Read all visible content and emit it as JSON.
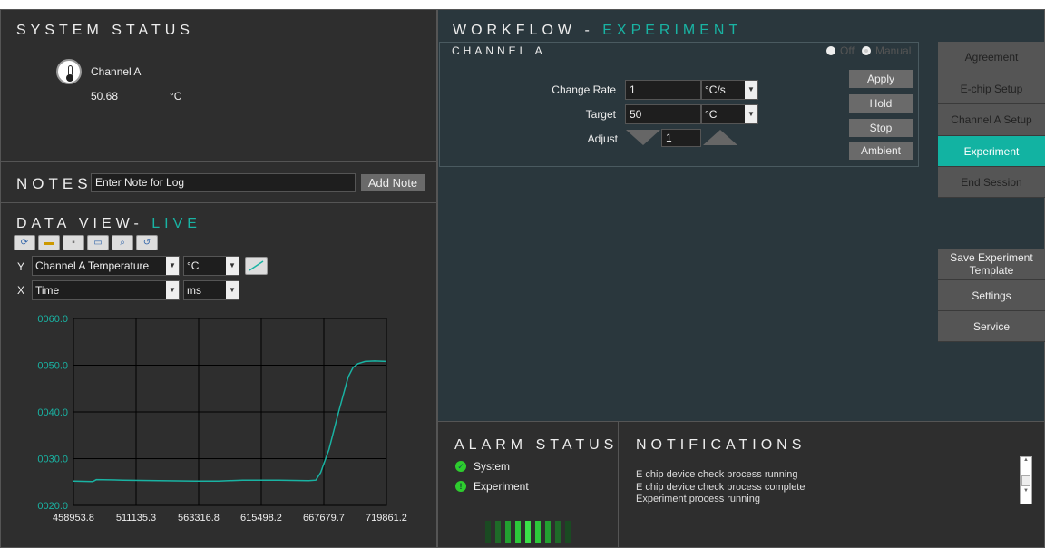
{
  "system_status": {
    "title": "SYSTEM STATUS",
    "channel": "Channel A",
    "value": "50.68",
    "unit": "°C"
  },
  "notes": {
    "title": "NOTES",
    "input_value": "Enter Note for Log",
    "add_label": "Add Note"
  },
  "data_view": {
    "title": "DATA VIEW-",
    "mode": "LIVE",
    "y_label": "Y",
    "y_select": "Channel A Temperature",
    "y_unit": "°C",
    "x_label": "X",
    "x_select": "Time",
    "x_unit": "ms",
    "toolbar": [
      "refresh-icon",
      "open-folder-icon",
      "save-icon",
      "new-window-icon",
      "zoom-fit-icon",
      "history-icon"
    ]
  },
  "chart_data": {
    "type": "line",
    "title": "",
    "xlabel": "",
    "ylabel": "",
    "xlim": [
      458953.8,
      719861.2
    ],
    "ylim": [
      20,
      60
    ],
    "x_ticks": [
      "458953.8",
      "511135.3",
      "563316.8",
      "615498.2",
      "667679.7",
      "719861.2"
    ],
    "y_ticks": [
      "0020.0",
      "0030.0",
      "0040.0",
      "0050.0",
      "0060.0"
    ],
    "grid": true,
    "color": "#19b3a3",
    "series": [
      {
        "name": "Channel A Temperature",
        "x": [
          458953.8,
          475000,
          478000,
          500000,
          530000,
          560000,
          580000,
          600000,
          630000,
          655000,
          661000,
          665000,
          672000,
          680000,
          688000,
          692000,
          696000,
          702000,
          710000,
          719861.2
        ],
        "y": [
          25.2,
          25.1,
          25.5,
          25.4,
          25.3,
          25.2,
          25.2,
          25.4,
          25.4,
          25.3,
          25.4,
          27,
          32,
          40,
          47.5,
          49.5,
          50.3,
          50.8,
          50.9,
          50.8
        ]
      }
    ]
  },
  "workflow": {
    "title": "WORKFLOW -",
    "mode": "EXPERIMENT",
    "channel_title": "CHANNEL A",
    "radio_off": "Off",
    "radio_manual": "Manual",
    "change_rate_label": "Change Rate",
    "change_rate": "1",
    "change_rate_unit": "°C/s",
    "target_label": "Target",
    "target": "50",
    "target_unit": "°C",
    "adjust_label": "Adjust",
    "adjust": "1",
    "apply": "Apply",
    "hold": "Hold",
    "stop": "Stop",
    "ambient": "Ambient"
  },
  "nav": {
    "agreement": "Agreement",
    "echip": "E-chip Setup",
    "channel_setup": "Channel A Setup",
    "experiment": "Experiment",
    "end_session": "End Session",
    "save_template": "Save Experiment Template",
    "settings": "Settings",
    "service": "Service"
  },
  "alarm": {
    "title": "ALARM STATUS",
    "system": "System",
    "experiment": "Experiment",
    "level_bars": 9,
    "colors": {
      "ok": "#2ecc2e"
    }
  },
  "notifications": {
    "title": "NOTIFICATIONS",
    "items": [
      "E chip device check process running",
      "E chip device check process complete",
      "Experiment process running"
    ]
  }
}
